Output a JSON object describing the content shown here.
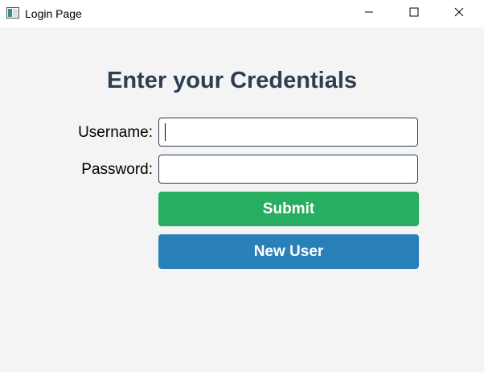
{
  "window": {
    "title": "Login Page",
    "controls": {
      "minimize": "minimize",
      "maximize": "maximize",
      "close": "close"
    }
  },
  "form": {
    "heading": "Enter your Credentials",
    "username_label": "Username:",
    "username_value": "",
    "password_label": "Password:",
    "password_value": "",
    "submit_label": "Submit",
    "new_user_label": "New User"
  },
  "colors": {
    "background": "#f4f4f4",
    "heading": "#2c3e50",
    "submit": "#27ae60",
    "new_user": "#2980b9"
  },
  "icons": {
    "app": "window-app-icon",
    "minimize": "minimize-icon",
    "maximize": "maximize-icon",
    "close": "close-icon"
  }
}
